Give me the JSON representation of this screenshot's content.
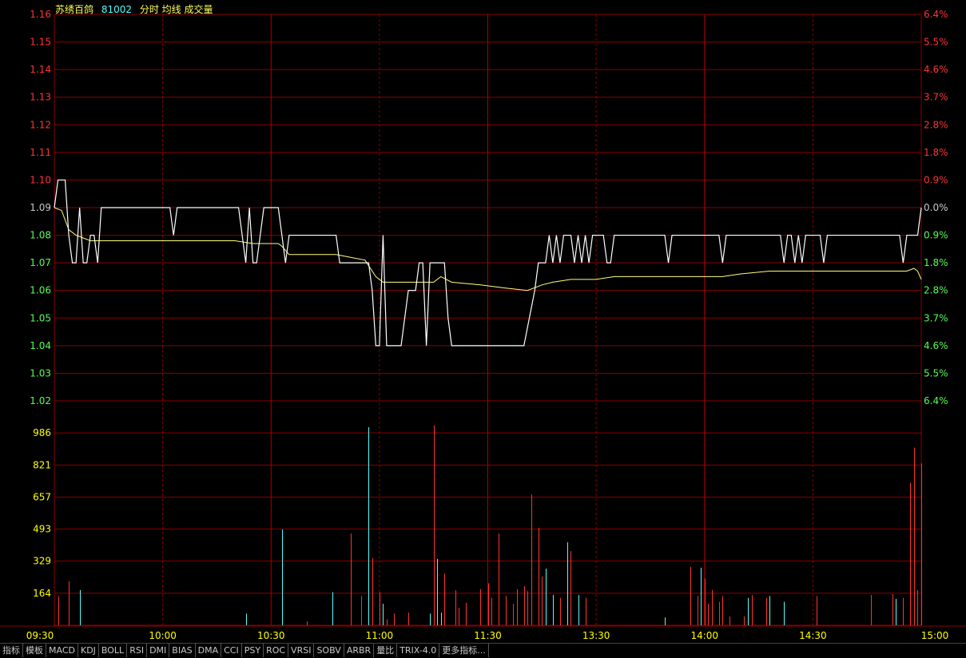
{
  "header": {
    "name": "苏绣百鸽",
    "code": "81002",
    "mode_label": "分时 均线 成交量"
  },
  "colors": {
    "grid": "#8b0000",
    "up": "#ff3232",
    "down": "#54ff54",
    "flat": "#c8c8c8",
    "price_line": "#ffffff",
    "avg_line": "#ffff80",
    "vol_up": "#ff3232",
    "vol_down": "#54ffff",
    "vol_axis": "#ffff00",
    "time_axis": "#ffff00"
  },
  "chart_data": {
    "type": "line",
    "prev_close": 1.09,
    "price_axis": {
      "labels": [
        "1.16",
        "1.15",
        "1.14",
        "1.13",
        "1.12",
        "1.11",
        "1.10",
        "1.09",
        "1.08",
        "1.07",
        "1.06",
        "1.05",
        "1.04",
        "1.03",
        "1.02"
      ],
      "pct_labels": [
        "6.4%",
        "5.5%",
        "4.6%",
        "3.7%",
        "2.8%",
        "1.8%",
        "0.9%",
        "0.0%",
        "0.9%",
        "1.8%",
        "2.8%",
        "3.7%",
        "4.6%",
        "5.5%",
        "6.4%"
      ]
    },
    "volume_axis": {
      "labels": [
        "986",
        "821",
        "657",
        "493",
        "329",
        "164"
      ],
      "max": 1150
    },
    "time_labels": [
      "09:30",
      "10:00",
      "10:30",
      "11:00",
      "11:30",
      "13:30",
      "14:00",
      "14:30",
      "15:00"
    ],
    "minutes_total": 240,
    "price_series": [
      [
        0,
        1.09
      ],
      [
        1,
        1.1
      ],
      [
        3,
        1.1
      ],
      [
        4,
        1.08
      ],
      [
        5,
        1.07
      ],
      [
        6,
        1.07
      ],
      [
        7,
        1.09
      ],
      [
        8,
        1.07
      ],
      [
        9,
        1.07
      ],
      [
        10,
        1.08
      ],
      [
        11,
        1.08
      ],
      [
        12,
        1.07
      ],
      [
        13,
        1.09
      ],
      [
        32,
        1.09
      ],
      [
        33,
        1.08
      ],
      [
        34,
        1.09
      ],
      [
        51,
        1.09
      ],
      [
        52,
        1.08
      ],
      [
        53,
        1.07
      ],
      [
        54,
        1.09
      ],
      [
        55,
        1.07
      ],
      [
        56,
        1.07
      ],
      [
        57,
        1.08
      ],
      [
        58,
        1.09
      ],
      [
        62,
        1.09
      ],
      [
        63,
        1.08
      ],
      [
        64,
        1.07
      ],
      [
        65,
        1.08
      ],
      [
        78,
        1.08
      ],
      [
        79,
        1.07
      ],
      [
        87,
        1.07
      ],
      [
        88,
        1.06
      ],
      [
        89,
        1.04
      ],
      [
        90,
        1.04
      ],
      [
        91,
        1.08
      ],
      [
        92,
        1.04
      ],
      [
        96,
        1.04
      ],
      [
        98,
        1.06
      ],
      [
        100,
        1.06
      ],
      [
        101,
        1.07
      ],
      [
        102,
        1.07
      ],
      [
        103,
        1.04
      ],
      [
        104,
        1.07
      ],
      [
        108,
        1.07
      ],
      [
        109,
        1.05
      ],
      [
        110,
        1.04
      ],
      [
        130,
        1.04
      ],
      [
        133,
        1.06
      ],
      [
        134,
        1.07
      ],
      [
        136,
        1.07
      ],
      [
        137,
        1.08
      ],
      [
        138,
        1.07
      ],
      [
        139,
        1.08
      ],
      [
        140,
        1.07
      ],
      [
        141,
        1.08
      ],
      [
        143,
        1.08
      ],
      [
        144,
        1.07
      ],
      [
        145,
        1.08
      ],
      [
        146,
        1.07
      ],
      [
        147,
        1.08
      ],
      [
        148,
        1.07
      ],
      [
        149,
        1.08
      ],
      [
        152,
        1.08
      ],
      [
        153,
        1.07
      ],
      [
        154,
        1.07
      ],
      [
        155,
        1.08
      ],
      [
        169,
        1.08
      ],
      [
        170,
        1.07
      ],
      [
        171,
        1.08
      ],
      [
        184,
        1.08
      ],
      [
        185,
        1.07
      ],
      [
        186,
        1.08
      ],
      [
        201,
        1.08
      ],
      [
        202,
        1.07
      ],
      [
        203,
        1.08
      ],
      [
        204,
        1.08
      ],
      [
        205,
        1.07
      ],
      [
        206,
        1.08
      ],
      [
        207,
        1.07
      ],
      [
        208,
        1.08
      ],
      [
        212,
        1.08
      ],
      [
        213,
        1.07
      ],
      [
        214,
        1.08
      ],
      [
        234,
        1.08
      ],
      [
        235,
        1.07
      ],
      [
        236,
        1.08
      ],
      [
        239,
        1.08
      ],
      [
        240,
        1.09
      ]
    ],
    "avg_series": [
      [
        0,
        1.09
      ],
      [
        2,
        1.089
      ],
      [
        4,
        1.082
      ],
      [
        6,
        1.08
      ],
      [
        8,
        1.079
      ],
      [
        10,
        1.078
      ],
      [
        30,
        1.078
      ],
      [
        50,
        1.078
      ],
      [
        55,
        1.077
      ],
      [
        62,
        1.077
      ],
      [
        63,
        1.076
      ],
      [
        65,
        1.073
      ],
      [
        78,
        1.073
      ],
      [
        82,
        1.072
      ],
      [
        86,
        1.071
      ],
      [
        89,
        1.065
      ],
      [
        91,
        1.063
      ],
      [
        100,
        1.063
      ],
      [
        104,
        1.063
      ],
      [
        105,
        1.063
      ],
      [
        107,
        1.065
      ],
      [
        110,
        1.063
      ],
      [
        118,
        1.062
      ],
      [
        124,
        1.061
      ],
      [
        131,
        1.06
      ],
      [
        135,
        1.062
      ],
      [
        138,
        1.063
      ],
      [
        143,
        1.064
      ],
      [
        150,
        1.064
      ],
      [
        155,
        1.065
      ],
      [
        160,
        1.065
      ],
      [
        180,
        1.065
      ],
      [
        185,
        1.065
      ],
      [
        190,
        1.066
      ],
      [
        198,
        1.067
      ],
      [
        210,
        1.067
      ],
      [
        225,
        1.067
      ],
      [
        236,
        1.067
      ],
      [
        238,
        1.068
      ],
      [
        239,
        1.067
      ],
      [
        240,
        1.064
      ]
    ],
    "volume_series": [
      {
        "t": 1,
        "v": 150,
        "up": true
      },
      {
        "t": 4,
        "v": 225,
        "up": true
      },
      {
        "t": 7,
        "v": 180,
        "up": false
      },
      {
        "t": 53,
        "v": 60,
        "up": false
      },
      {
        "t": 63,
        "v": 490,
        "up": false
      },
      {
        "t": 70,
        "v": 20,
        "up": true
      },
      {
        "t": 77,
        "v": 170,
        "up": false
      },
      {
        "t": 82,
        "v": 470,
        "up": true
      },
      {
        "t": 85,
        "v": 150,
        "up": true
      },
      {
        "t": 87,
        "v": 1015,
        "up": false
      },
      {
        "t": 88,
        "v": 345,
        "up": true
      },
      {
        "t": 90,
        "v": 170,
        "up": true
      },
      {
        "t": 91,
        "v": 110,
        "up": false
      },
      {
        "t": 92,
        "v": 30,
        "up": true
      },
      {
        "t": 94,
        "v": 60,
        "up": true
      },
      {
        "t": 98,
        "v": 65,
        "up": true
      },
      {
        "t": 104,
        "v": 60,
        "up": false
      },
      {
        "t": 105,
        "v": 1025,
        "up": true
      },
      {
        "t": 106,
        "v": 340,
        "up": false
      },
      {
        "t": 107,
        "v": 65,
        "up": false
      },
      {
        "t": 108,
        "v": 265,
        "up": true
      },
      {
        "t": 111,
        "v": 180,
        "up": true
      },
      {
        "t": 112,
        "v": 90,
        "up": true
      },
      {
        "t": 114,
        "v": 115,
        "up": true
      },
      {
        "t": 118,
        "v": 185,
        "up": true
      },
      {
        "t": 120,
        "v": 215,
        "up": true
      },
      {
        "t": 121,
        "v": 140,
        "up": true
      },
      {
        "t": 123,
        "v": 470,
        "up": true
      },
      {
        "t": 125,
        "v": 150,
        "up": true
      },
      {
        "t": 127,
        "v": 110,
        "up": true
      },
      {
        "t": 128,
        "v": 185,
        "up": true
      },
      {
        "t": 130,
        "v": 200,
        "up": true
      },
      {
        "t": 131,
        "v": 175,
        "up": true
      },
      {
        "t": 132,
        "v": 670,
        "up": true
      },
      {
        "t": 134,
        "v": 500,
        "up": true
      },
      {
        "t": 135,
        "v": 250,
        "up": true
      },
      {
        "t": 136,
        "v": 290,
        "up": false
      },
      {
        "t": 138,
        "v": 155,
        "up": false
      },
      {
        "t": 140,
        "v": 140,
        "up": true
      },
      {
        "t": 142,
        "v": 425,
        "up": false
      },
      {
        "t": 143,
        "v": 380,
        "up": true
      },
      {
        "t": 145,
        "v": 155,
        "up": false
      },
      {
        "t": 147,
        "v": 140,
        "up": true
      },
      {
        "t": 169,
        "v": 40,
        "up": false
      },
      {
        "t": 176,
        "v": 300,
        "up": true
      },
      {
        "t": 178,
        "v": 150,
        "up": true
      },
      {
        "t": 179,
        "v": 295,
        "up": false
      },
      {
        "t": 180,
        "v": 240,
        "up": true
      },
      {
        "t": 181,
        "v": 110,
        "up": true
      },
      {
        "t": 182,
        "v": 180,
        "up": true
      },
      {
        "t": 184,
        "v": 120,
        "up": true
      },
      {
        "t": 185,
        "v": 150,
        "up": true
      },
      {
        "t": 187,
        "v": 45,
        "up": true
      },
      {
        "t": 191,
        "v": 45,
        "up": true
      },
      {
        "t": 192,
        "v": 140,
        "up": false
      },
      {
        "t": 193,
        "v": 155,
        "up": true
      },
      {
        "t": 197,
        "v": 140,
        "up": true
      },
      {
        "t": 198,
        "v": 150,
        "up": false
      },
      {
        "t": 202,
        "v": 120,
        "up": false
      },
      {
        "t": 211,
        "v": 150,
        "up": true
      },
      {
        "t": 226,
        "v": 155,
        "up": true
      },
      {
        "t": 232,
        "v": 160,
        "up": true
      },
      {
        "t": 233,
        "v": 135,
        "up": false
      },
      {
        "t": 235,
        "v": 140,
        "up": true
      },
      {
        "t": 237,
        "v": 730,
        "up": true
      },
      {
        "t": 238,
        "v": 910,
        "up": true
      },
      {
        "t": 239,
        "v": 180,
        "up": true
      },
      {
        "t": 240,
        "v": 830,
        "up": true
      }
    ]
  },
  "toolbar": {
    "items": [
      "指标",
      "模板",
      "MACD",
      "KDJ",
      "BOLL",
      "RSI",
      "DMI",
      "BIAS",
      "DMA",
      "CCI",
      "PSY",
      "ROC",
      "VRSI",
      "SOBV",
      "ARBR",
      "量比",
      "TRIX-4.0",
      "更多指标..."
    ]
  }
}
